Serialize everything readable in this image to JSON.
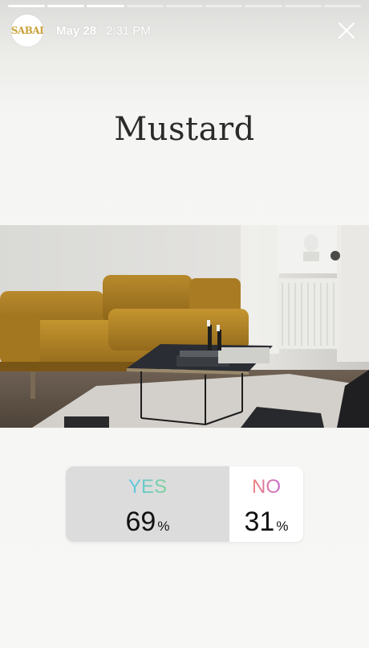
{
  "story": {
    "segments_total": 9,
    "segments_complete": 3,
    "colors": {
      "accent_yes_from": "#5cc6e6",
      "accent_yes_to": "#7fd19a",
      "accent_no_from": "#f0857a",
      "accent_no_to": "#c46bcb"
    }
  },
  "header": {
    "avatar_text": "SABAI",
    "date": "May 28",
    "time": "2:31 PM",
    "close_icon": "close-icon"
  },
  "title": "Mustard",
  "photo": {
    "subject": "mustard velvet sofa with black coffee table"
  },
  "poll": {
    "yes_label": "YES",
    "yes_percent": "69",
    "no_label": "NO",
    "no_percent": "31",
    "percent_sign": "%",
    "yes_fraction": 0.69
  }
}
